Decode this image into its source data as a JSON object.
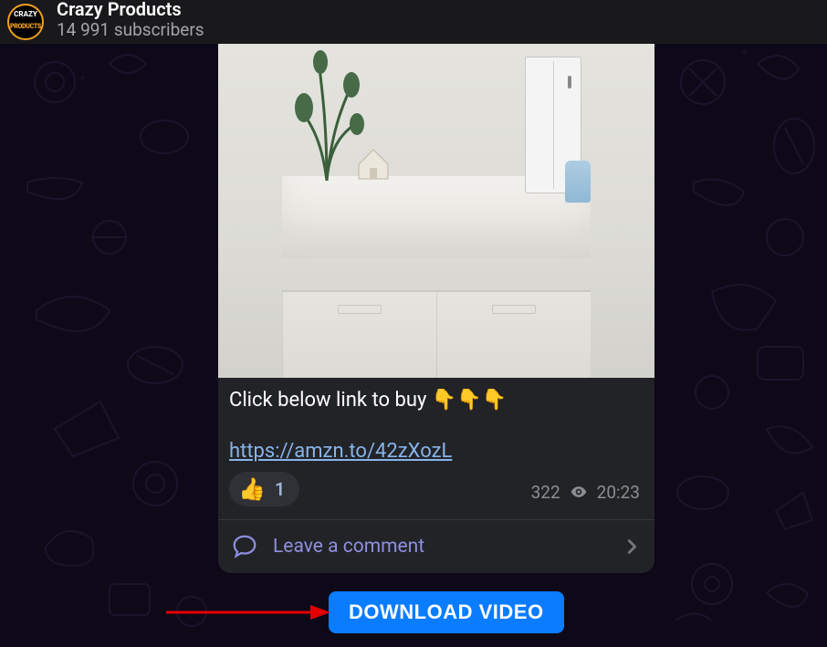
{
  "header": {
    "avatar_line1": "CRAZY",
    "avatar_line2": "PRODUCTS",
    "channel_name": "Crazy Products",
    "subscribers": "14 991 subscribers"
  },
  "message": {
    "text": "Click below link to buy ",
    "emoji": "👇👇👇",
    "link": "https://amzn.to/42zXozL",
    "reaction_emoji": "👍",
    "reaction_count": "1",
    "views": "322",
    "time": "20:23",
    "comment_label": "Leave a comment"
  },
  "download": {
    "label": "DOWNLOAD VIDEO"
  }
}
